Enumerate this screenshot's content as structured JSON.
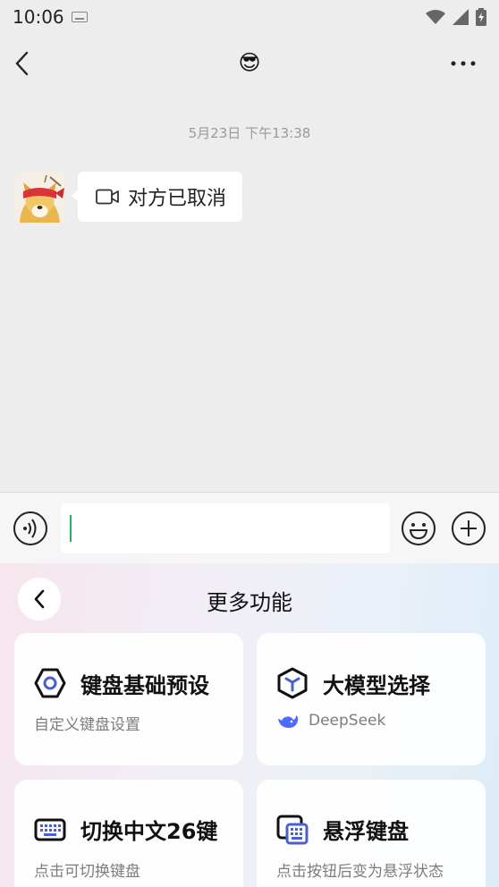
{
  "status": {
    "time": "10:06"
  },
  "nav": {
    "title": "😎"
  },
  "chat": {
    "timestamp": "5月23日 下午13:38",
    "message": "对方已取消"
  },
  "panel": {
    "title": "更多功能",
    "cards": [
      {
        "title": "键盘基础预设",
        "subtitle": "自定义键盘设置"
      },
      {
        "title": "大模型选择",
        "subtitle": "DeepSeek"
      },
      {
        "title": "切换中文26键",
        "subtitle": "点击可切换键盘"
      },
      {
        "title": "悬浮键盘",
        "subtitle": "点击按钮后变为悬浮状态"
      }
    ]
  },
  "colors": {
    "accent": "#2aae67",
    "icon_blue": "#4a5fd0",
    "deepseek_blue": "#4d6bfe"
  }
}
